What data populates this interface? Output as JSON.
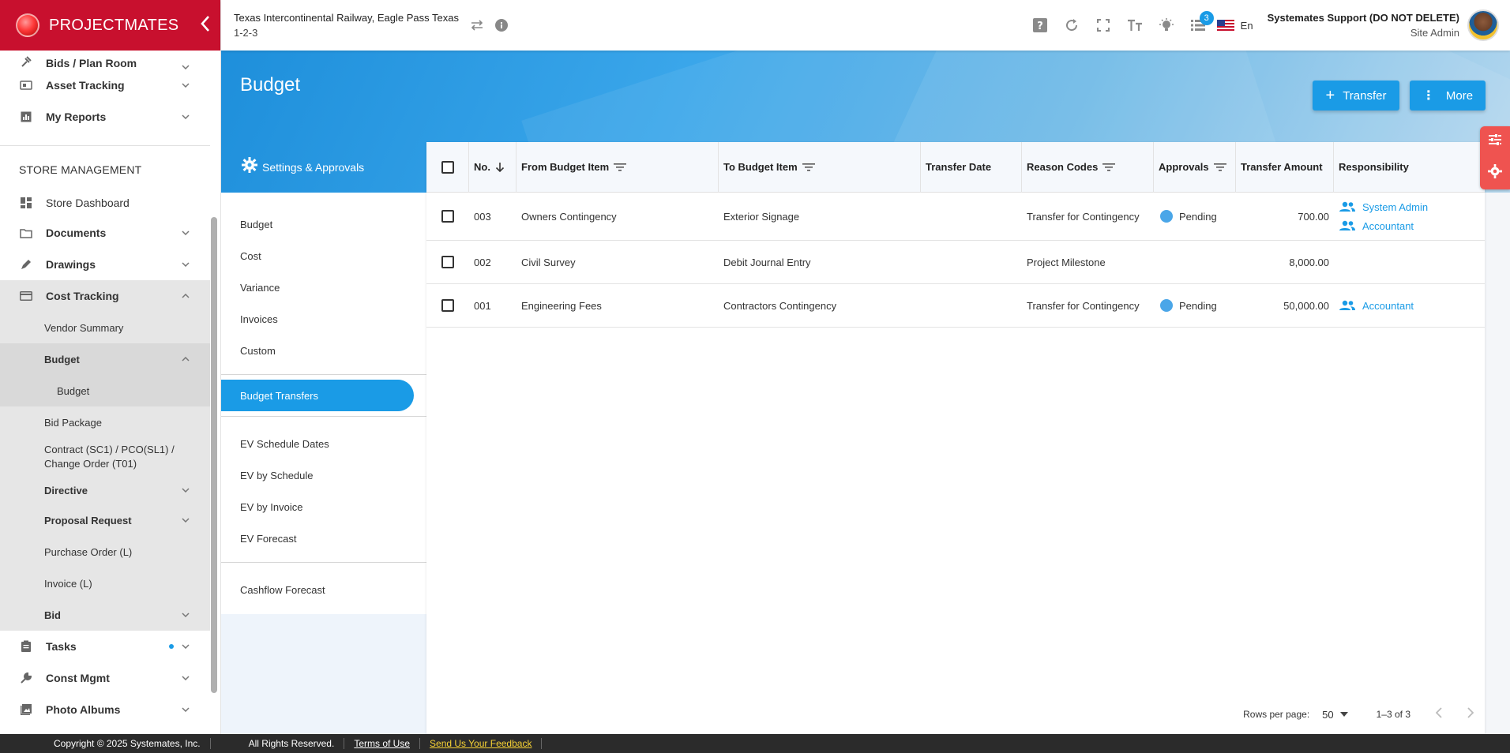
{
  "brand": {
    "name": "PROJECTMATES"
  },
  "sidebar": {
    "top_items": [
      {
        "label": "Bids / Plan Room"
      },
      {
        "label": "Asset Tracking"
      },
      {
        "label": "My Reports"
      }
    ],
    "section_title": "STORE MANAGEMENT",
    "store_items": {
      "dashboard": "Store Dashboard",
      "documents": "Documents",
      "drawings": "Drawings",
      "cost_tracking": "Cost Tracking",
      "vendor_summary": "Vendor Summary",
      "budget": "Budget",
      "budget_sub": "Budget",
      "bid_package": "Bid Package",
      "contract": "Contract (SC1) / PCO(SL1) / Change Order (T01)",
      "directive": "Directive",
      "proposal_request": "Proposal Request",
      "purchase_order": "Purchase Order (L)",
      "invoice": "Invoice (L)",
      "bid": "Bid",
      "tasks": "Tasks",
      "const_mgmt": "Const Mgmt",
      "photo_albums": "Photo Albums"
    }
  },
  "topbar": {
    "project_name": "Texas Intercontinental Railway, Eagle Pass Texas",
    "project_code": "1-2-3",
    "notifications_count": "3",
    "language": "En",
    "user_name": "Systemates Support (DO NOT DELETE)",
    "user_role": "Site Admin"
  },
  "page": {
    "title": "Budget",
    "transfer_button": "Transfer",
    "more_button": "More",
    "settings_label": "Settings & Approvals"
  },
  "subnav": {
    "group1": [
      "Budget",
      "Cost",
      "Variance",
      "Invoices",
      "Custom"
    ],
    "active": "Budget Transfers",
    "group2": [
      "EV Schedule Dates",
      "EV by Schedule",
      "EV by Invoice",
      "EV Forecast"
    ],
    "group3": [
      "Cashflow Forecast"
    ]
  },
  "table": {
    "columns": [
      "No.",
      "From Budget Item",
      "To Budget Item",
      "Transfer Date",
      "Reason Codes",
      "Approvals",
      "Transfer Amount",
      "Responsibility"
    ],
    "rows": [
      {
        "no": "003",
        "from": "Owners Contingency",
        "to": "Exterior Signage",
        "date": "",
        "reason": "Transfer for Contingency",
        "approval": "Pending",
        "amount": "700.00",
        "responsibility": [
          "System Admin",
          "Accountant"
        ]
      },
      {
        "no": "002",
        "from": "Civil Survey",
        "to": "Debit Journal Entry",
        "date": "",
        "reason": "Project Milestone",
        "approval": "",
        "amount": "8,000.00",
        "responsibility": []
      },
      {
        "no": "001",
        "from": "Engineering Fees",
        "to": "Contractors Contingency",
        "date": "",
        "reason": "Transfer for Contingency",
        "approval": "Pending",
        "amount": "50,000.00",
        "responsibility": [
          "Accountant"
        ]
      }
    ],
    "pager": {
      "rows_per_page_label": "Rows per page:",
      "rows_per_page": "50",
      "range": "1–3 of 3"
    }
  },
  "footer": {
    "copyright": "Copyright © 2025 Systemates, Inc.",
    "rights": "All Rights Reserved.",
    "terms": "Terms of Use",
    "feedback": "Send Us Your Feedback"
  },
  "colors": {
    "brand_red": "#c8102e",
    "accent_blue": "#1a9be6",
    "status_pending": "#4aa6e8"
  }
}
